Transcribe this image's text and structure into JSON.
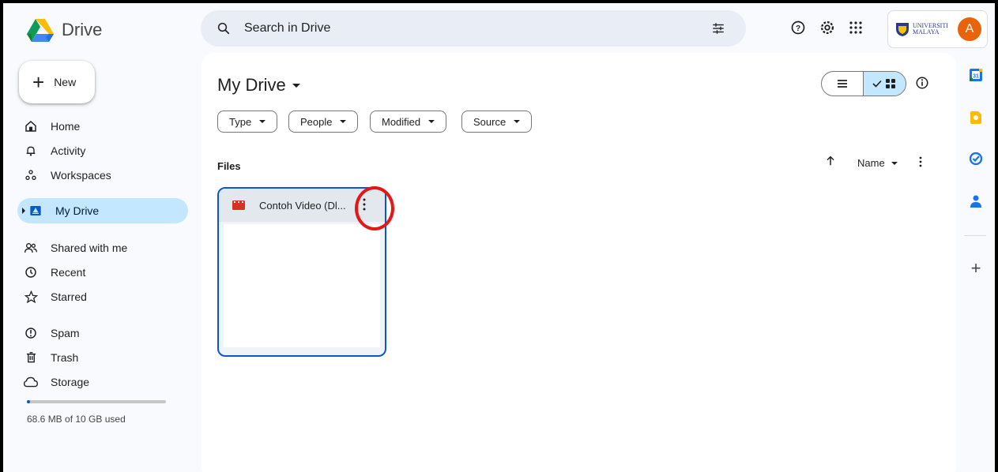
{
  "app": {
    "title": "Drive"
  },
  "search": {
    "placeholder": "Search in Drive"
  },
  "account": {
    "org_line1": "UNIVERSITI",
    "org_line2": "MALAYA",
    "avatar_letter": "A",
    "avatar_color": "#e8630a"
  },
  "sidebar": {
    "new_label": "New",
    "items": [
      {
        "label": "Home",
        "icon": "home-icon"
      },
      {
        "label": "Activity",
        "icon": "bell-icon"
      },
      {
        "label": "Workspaces",
        "icon": "workspaces-icon"
      },
      {
        "label": "My Drive",
        "icon": "drive-icon",
        "active": true
      },
      {
        "label": "Shared with me",
        "icon": "people-icon"
      },
      {
        "label": "Recent",
        "icon": "clock-icon"
      },
      {
        "label": "Starred",
        "icon": "star-icon"
      },
      {
        "label": "Spam",
        "icon": "spam-icon"
      },
      {
        "label": "Trash",
        "icon": "trash-icon"
      },
      {
        "label": "Storage",
        "icon": "cloud-icon"
      }
    ],
    "storage_text": "68.6 MB of 10 GB used",
    "storage_fraction": 0.007
  },
  "main": {
    "title": "My Drive",
    "filters": [
      "Type",
      "People",
      "Modified",
      "Source"
    ],
    "section_label": "Files",
    "sort_label": "Name",
    "files": [
      {
        "name": "Contoh Video (Dl...",
        "icon": "video-file-icon"
      }
    ]
  },
  "colors": {
    "accent": "#0b57d0",
    "active_bg": "#c2e7ff",
    "highlight": "#e51616"
  }
}
